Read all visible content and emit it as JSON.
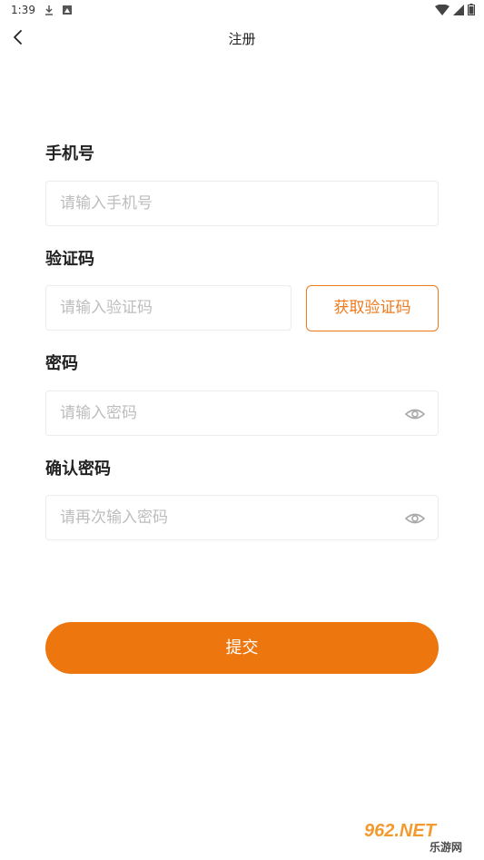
{
  "status": {
    "time": "1:39"
  },
  "nav": {
    "title": "注册"
  },
  "form": {
    "phone": {
      "label": "手机号",
      "placeholder": "请输入手机号",
      "value": ""
    },
    "code": {
      "label": "验证码",
      "placeholder": "请输入验证码",
      "value": "",
      "button": "获取验证码"
    },
    "password": {
      "label": "密码",
      "placeholder": "请输入密码",
      "value": ""
    },
    "confirm": {
      "label": "确认密码",
      "placeholder": "请再次输入密码",
      "value": ""
    }
  },
  "submit": {
    "label": "提交"
  },
  "watermark": {
    "brand": "962.NET",
    "sub": "乐游网"
  },
  "colors": {
    "accent": "#ed760f",
    "accent_border": "#ee7a1c",
    "placeholder": "#bdbdbd"
  },
  "icons": [
    "back-icon",
    "eye-icon",
    "download-icon",
    "image-icon",
    "wifi-icon",
    "signal-icon",
    "battery-icon"
  ]
}
